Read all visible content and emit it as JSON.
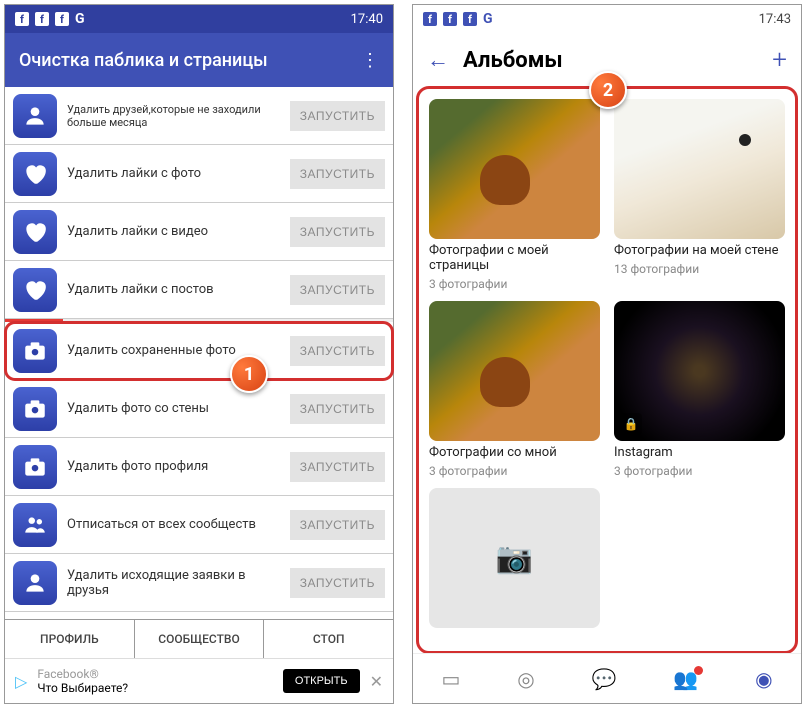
{
  "left": {
    "time": "17:40",
    "g_icon": "G",
    "title": "Очистка паблика и страницы",
    "rows": [
      {
        "icon": "person",
        "label": "Удалить друзей,которые не заходили больше месяца",
        "btn": "ЗАПУСТИТЬ",
        "small": true
      },
      {
        "icon": "heart",
        "label": "Удалить лайки с фото",
        "btn": "ЗАПУСТИТЬ"
      },
      {
        "icon": "heart",
        "label": "Удалить лайки с видео",
        "btn": "ЗАПУСТИТЬ"
      },
      {
        "icon": "heart",
        "label": "Удалить лайки с постов",
        "btn": "ЗАПУСТИТЬ"
      },
      {
        "icon": "camera",
        "label": "Удалить сохраненные фото",
        "btn": "ЗАПУСТИТЬ",
        "selected": true
      },
      {
        "icon": "camera",
        "label": "Удалить фото со стены",
        "btn": "ЗАПУСТИТЬ"
      },
      {
        "icon": "camera",
        "label": "Удалить фото профиля",
        "btn": "ЗАПУСТИТЬ"
      },
      {
        "icon": "people",
        "label": "Отписаться от всех сообществ",
        "btn": "ЗАПУСТИТЬ"
      },
      {
        "icon": "person",
        "label": "Удалить исходящие заявки в друзья",
        "btn": "ЗАПУСТИТЬ"
      }
    ],
    "tabs": [
      "ПРОФИЛЬ",
      "СООБЩЕСТВО",
      "СТОП"
    ],
    "ad": {
      "brand": "Facebook®",
      "text": "Что Выбираете?",
      "open": "ОТКРЫТЬ",
      "close": "✕"
    }
  },
  "right": {
    "time": "17:43",
    "g_icon": "G",
    "title": "Альбомы",
    "albums": [
      {
        "title": "Фотографии с моей страницы",
        "count": "3 фотографии",
        "thumb": "dog"
      },
      {
        "title": "Фотографии на моей стене",
        "count": "13 фотографии",
        "thumb": "fox"
      },
      {
        "title": "Фотографии со мной",
        "count": "3 фотографии",
        "thumb": "dog"
      },
      {
        "title": "Instagram",
        "count": "3 фотографии",
        "thumb": "galaxy",
        "lock": true
      }
    ]
  },
  "markers": {
    "m1": "1",
    "m2": "2"
  }
}
